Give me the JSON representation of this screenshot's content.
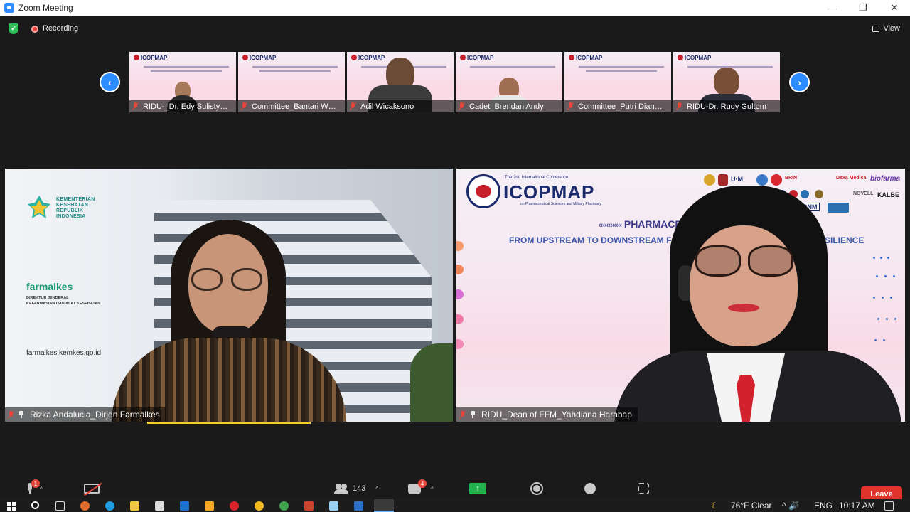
{
  "window": {
    "title": "Zoom Meeting",
    "minimize": "—",
    "restore": "❐",
    "close": "✕"
  },
  "status": {
    "security_glyph": "✓",
    "recording_label": "Recording",
    "view_label": "View"
  },
  "filmstrip": {
    "prev": "‹",
    "next": "›",
    "participants": [
      {
        "name": "RIDU-_Dr. Edy Sulisty…"
      },
      {
        "name": "Committee_Bantari W…"
      },
      {
        "name": "Adil Wicaksono"
      },
      {
        "name": "Cadet_Brendan Andy"
      },
      {
        "name": "Committee_Putri Dian…"
      },
      {
        "name": "RIDU-Dr. Rudy Gultom"
      }
    ],
    "thumb_logo": "ICOPMAP"
  },
  "main_tiles": {
    "left": {
      "name": "Rizka Andalucia_Dirjen Farmalkes",
      "logo_lines": [
        "KEMENTERIAN",
        "KESEHATAN",
        "REPUBLIK",
        "INDONESIA"
      ],
      "brand": "farmalkes",
      "brand_sub_1": "DIREKTUR JENDERAL",
      "brand_sub_2": "KEFARMASIAN DAN ALAT KESEHATAN",
      "url": "farmalkes.kemkes.go.id"
    },
    "right": {
      "name": "RIDU_Dean of FFM_Yahdiana Harahap",
      "conf_small": "The 2nd International Conference",
      "conf_name": "ICOPMAP",
      "conf_sub": "on Pharmaceutical Sciences and Military Pharmacy",
      "slide_title_chevrons": "‹‹‹‹‹‹‹‹‹‹‹‹",
      "slide_title": "PHARMACEUTICAL",
      "slide_subtitle": "FROM UPSTREAM TO DOWNSTREAM F",
      "slide_subtitle_tail": "TH RESILIENCE",
      "sponsors": [
        "U·M",
        "BRIN",
        "Dexa Medica",
        "biofarma",
        "NOVELL",
        "KALBE",
        "BNM"
      ]
    }
  },
  "toolbar": {
    "mic_badge": "1",
    "participants_count": "143",
    "chat_badge": "4",
    "share_glyph": "↑",
    "caret": "^",
    "leave_label": "Leave"
  },
  "taskbar": {
    "weather": "76°F  Clear",
    "tray_icons": "^  🔊  ",
    "language": "ENG",
    "time": "10:17 AM"
  },
  "colors": {
    "zoom_blue": "#2d8cff",
    "leave_red": "#e0332b",
    "share_green": "#23b14d",
    "speaking_yellow": "#f0d227"
  }
}
